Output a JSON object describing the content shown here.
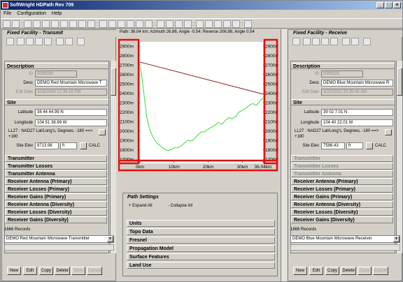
{
  "window": {
    "title": "SoftWright HDPath Rev 709"
  },
  "menu": [
    "File",
    "Configuration",
    "Help"
  ],
  "path_info": "Path: 36.04 km; Azimuth 26.86, Angle -0.54; Reverse 206.98, Angle 0.54",
  "left": {
    "title": "Fixed Facility - Transmit",
    "description_header": "Description",
    "id_label": "ID",
    "id_value": "0000030",
    "desc_label": "Desc",
    "desc_value": "DEMO Red Mountain Microwave T",
    "edit_date_label": "Edit Date",
    "edit_date_value": "3/28/2006 12:39:18 PM",
    "site_header": "Site",
    "lat_label": "Latitude",
    "lat_value": "38 44 44.99 N",
    "lon_label": "Longitude",
    "lon_value": "104 51 38.99 W",
    "datum_text": "LL27 : NAD27 Lat/Long's, Degrees, -180 ==> +180",
    "elev_label": "Site Elev",
    "elev_value": "8713.98",
    "elev_unit": "ft",
    "calc": "CALC",
    "sections": [
      "Transmitter",
      "Transmitter Losses",
      "Transmitter Antenna",
      "Receiver Antenna (Primary)",
      "Receiver Losses (Primary)",
      "Receiver Gains (Primary)",
      "Receiver Antenna (Diversity)",
      "Receiver Losses (Diversity)",
      "Receiver Gains (Diversity)"
    ],
    "records": "1666 Records",
    "combo": "DEMO Red Mountain Microwave Transmitter"
  },
  "right": {
    "title": "Fixed Facility - Receive",
    "description_header": "Description",
    "id_label": "ID",
    "id_value": "0000025",
    "desc_label": "Desc",
    "desc_value": "DEMO Blue Mountain Microwave R",
    "edit_date_label": "Edit Date",
    "edit_date_value": "3/22/2010 10:35:45 AM",
    "site_header": "Site",
    "lat_label": "Latitude",
    "lat_value": "39 02 7.01 N",
    "lon_label": "Longitude",
    "lon_value": "104 40 22.01 W",
    "datum_text": "LL27 : NAD27 Lat/Long's, Degrees, -180 ==> +180",
    "elev_label": "Site Elev",
    "elev_value": "7598.43",
    "elev_unit": "ft",
    "calc": "CALC",
    "sections": [
      "Transmitter",
      "Transmitter Losses",
      "Transmitter Antenna",
      "Receiver Antenna (Primary)",
      "Receiver Losses (Primary)",
      "Receiver Gains (Primary)",
      "Receiver Antenna (Diversity)",
      "Receiver Losses (Diversity)",
      "Receiver Gains (Diversity)"
    ],
    "records": "1666 Records",
    "combo": "DEMO Blue Mountain Microwave Receiver"
  },
  "buttons": [
    "New",
    "Edit",
    "Copy",
    "Delete",
    "Save",
    "Cancel"
  ],
  "path_settings": {
    "title": "Path Settings",
    "expand": "+ Expand All",
    "collapse": "- Collapse All",
    "rows": [
      "Units",
      "Topo Data",
      "Fresnel",
      "Propagation Model",
      "Surface Features",
      "Land Use"
    ]
  },
  "colors": {
    "terrain": "#33dd33",
    "ray": "#8b1a1a",
    "highlight": "#e01010",
    "title_start": "#0a246a"
  },
  "chart_data": {
    "type": "line",
    "y_ticks": [
      "2900m",
      "2800m",
      "2700m",
      "2600m",
      "2500m",
      "2400m",
      "2300m",
      "2200m",
      "2100m",
      "2000m",
      "1900m",
      "1800m",
      "1700m"
    ],
    "x_ticks": [
      "0km",
      "10km",
      "20km",
      "30km",
      "36.04km"
    ],
    "ylim": [
      1700,
      2900
    ],
    "xlim": [
      0,
      36.04
    ],
    "series": [
      {
        "x": [
          0,
          0.5,
          1,
          1.5,
          2,
          2.5,
          3,
          3.5,
          4,
          5,
          6,
          7,
          8,
          9,
          10,
          11,
          12,
          13,
          14,
          15,
          16,
          17,
          18,
          19,
          20,
          21,
          22,
          23,
          24,
          25,
          26,
          27,
          28,
          29,
          30,
          31,
          32,
          33,
          34,
          35,
          36.04
        ],
        "values": [
          2680,
          2600,
          2440,
          2290,
          2150,
          2060,
          2000,
          1960,
          1920,
          1870,
          1840,
          1810,
          1790,
          1800,
          1820,
          1820,
          1840,
          1870,
          1900,
          1890,
          1920,
          1960,
          1990,
          1990,
          2020,
          2040,
          2060,
          2090,
          2070,
          2110,
          2140,
          2130,
          2150,
          2200,
          2220,
          2240,
          2270,
          2290,
          2270,
          2310,
          2350
        ]
      },
      {
        "x": [
          0,
          36.04
        ],
        "values": [
          2730,
          2390
        ]
      }
    ]
  }
}
